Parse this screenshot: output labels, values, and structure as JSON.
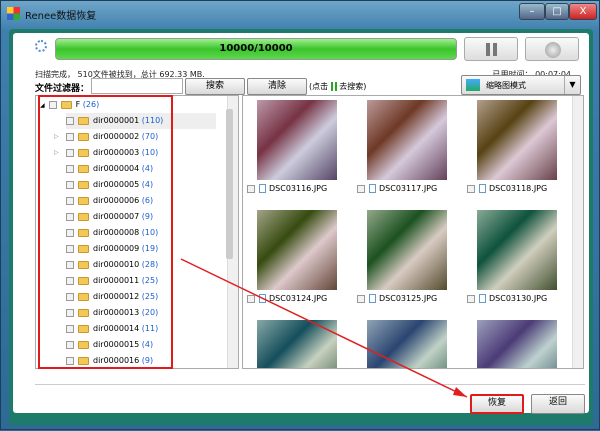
{
  "window": {
    "title": "Renee数据恢复",
    "min": "–",
    "max": "□",
    "close": "X"
  },
  "progress": {
    "label": "10000/10000",
    "percent": 100
  },
  "status": "扫描完成， 510文件被找到，总计 692.33 MB.",
  "elapsed": {
    "label": "已用时间：",
    "value": "00:07:04"
  },
  "filter": {
    "label": "文件过滤器：",
    "value": "",
    "search": "搜索",
    "clear": "清除",
    "hint_pre": "(点击",
    "hint_post": "去搜索)"
  },
  "view_mode": "缩略图模式",
  "tree": {
    "root": {
      "name": "F",
      "count": "(26)"
    },
    "items": [
      {
        "name": "dir0000001",
        "count": "(110)"
      },
      {
        "name": "dir0000002",
        "count": "(70)"
      },
      {
        "name": "dir0000003",
        "count": "(10)"
      },
      {
        "name": "dir0000004",
        "count": "(4)"
      },
      {
        "name": "dir0000005",
        "count": "(4)"
      },
      {
        "name": "dir0000006",
        "count": "(6)"
      },
      {
        "name": "dir0000007",
        "count": "(9)"
      },
      {
        "name": "dir0000008",
        "count": "(10)"
      },
      {
        "name": "dir0000009",
        "count": "(19)"
      },
      {
        "name": "dir0000010",
        "count": "(28)"
      },
      {
        "name": "dir0000011",
        "count": "(25)"
      },
      {
        "name": "dir0000012",
        "count": "(25)"
      },
      {
        "name": "dir0000013",
        "count": "(20)"
      },
      {
        "name": "dir0000014",
        "count": "(11)"
      },
      {
        "name": "dir0000015",
        "count": "(4)"
      },
      {
        "name": "dir0000016",
        "count": "(9)"
      }
    ]
  },
  "files": [
    "DSC03116.JPG",
    "DSC03117.JPG",
    "DSC03118.JPG",
    "DSC03124.JPG",
    "DSC03125.JPG",
    "DSC03130.JPG"
  ],
  "footer": {
    "recover": "恢复",
    "back": "返回"
  }
}
